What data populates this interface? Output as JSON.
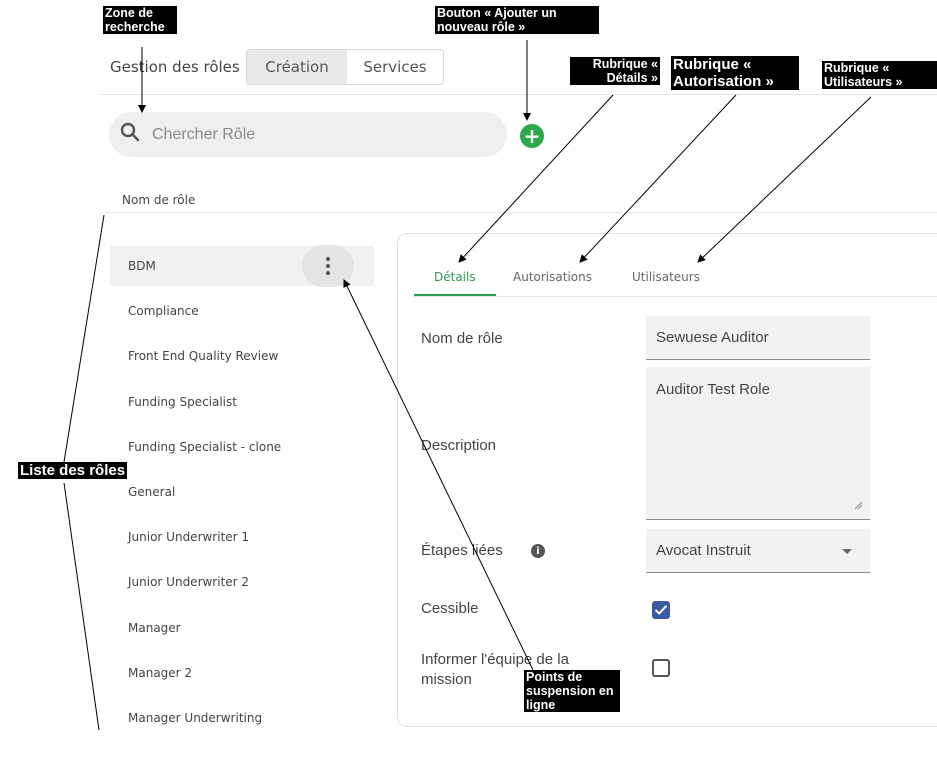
{
  "header": {
    "app_title": "Gestion des rôles",
    "tabs": [
      "Création",
      "Services"
    ]
  },
  "search": {
    "placeholder": "Chercher Rôle"
  },
  "add_button": "+",
  "list": {
    "column_header": "Nom de rôle",
    "roles": [
      "BDM",
      "Compliance",
      "Front End Quality Review",
      "Funding Specialist",
      "Funding Specialist - clone",
      "General",
      "Junior Underwriter 1",
      "Junior Underwriter 2",
      "Manager",
      "Manager 2",
      "Manager Underwriting"
    ]
  },
  "detail": {
    "tabs": [
      "Détails",
      "Autorisations",
      "Utilisateurs"
    ],
    "labels": {
      "role_name": "Nom de rôle",
      "description": "Description",
      "linked_steps": "Étapes liées",
      "transferable": "Cessible",
      "notify_team": "Informer l'équipe de la mission"
    },
    "values": {
      "role_name": "Sewuese Auditor",
      "description": "Auditor Test Role",
      "linked_steps": "Avocat Instruit"
    },
    "checkboxes": {
      "transferable": true,
      "notify_team": false
    }
  },
  "annotations": {
    "search_zone": "Zone de recherche",
    "add_role_button": "Bouton « Ajouter un nouveau rôle »",
    "details_section": "Rubrique « Détails »",
    "authorization_section": "Rubrique « Autorisation »",
    "users_section": "Rubrique « Utilisateurs »",
    "role_list": "Liste des rôles",
    "inline_ellipsis": "Points de suspension en ligne"
  },
  "colors": {
    "accent_green": "#2e9a4a",
    "checkbox_blue": "#3b5aa6"
  }
}
